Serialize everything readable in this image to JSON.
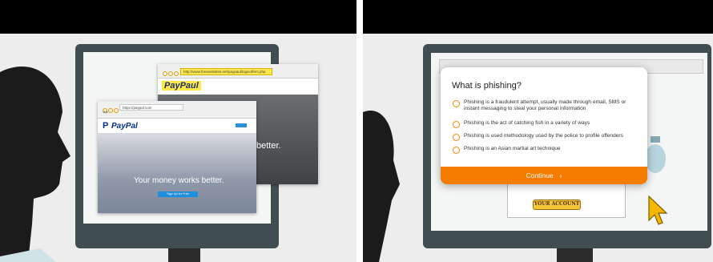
{
  "left_scene": {
    "phishing_window": {
      "url": "http://www.freewebsites.net/paypaul/loginoffers.php",
      "brand": "PayPaul",
      "overlay_text": "better."
    },
    "real_window": {
      "url": "https://paypal.com",
      "brand": "PayPal",
      "hero_text": "Your money works better.",
      "cta": "Sign Up for Free"
    }
  },
  "quiz": {
    "question": "What is phishing?",
    "options": [
      "Phishing is a fraudulent attempt, usually made through email, SMS or instant messaging to steal your personal information",
      "Phishing is the act of catching fish in a variety of ways",
      "Phishing is used methodology used by the police to profile offenders",
      "Phishing is an Asian martial art technique"
    ],
    "continue_label": "Continue",
    "continue_arrow": "›"
  },
  "right_scene": {
    "account_button": "YOUR ACCOUNT"
  },
  "colors": {
    "accent": "#f47c00",
    "monitor": "#414e51",
    "paypal_blue": "#003087"
  }
}
